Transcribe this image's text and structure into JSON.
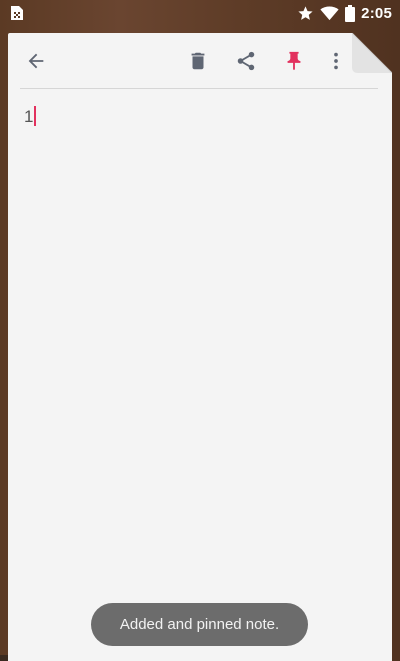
{
  "status_bar": {
    "time": "2:05",
    "icons": [
      "notification-app-icon",
      "star-icon",
      "wifi-icon",
      "battery-icon"
    ]
  },
  "toolbar": {
    "icons": {
      "back": "arrow-back-icon",
      "delete": "trash-icon",
      "share": "share-icon",
      "pin": "pin-icon",
      "more": "more-vert-icon"
    }
  },
  "note": {
    "body": "1"
  },
  "toast": {
    "message": "Added and pinned note."
  },
  "colors": {
    "accent": "#e2315e",
    "icon_gray": "#5f6673",
    "card": "#f4f4f4",
    "toast_bg": "#606060"
  }
}
